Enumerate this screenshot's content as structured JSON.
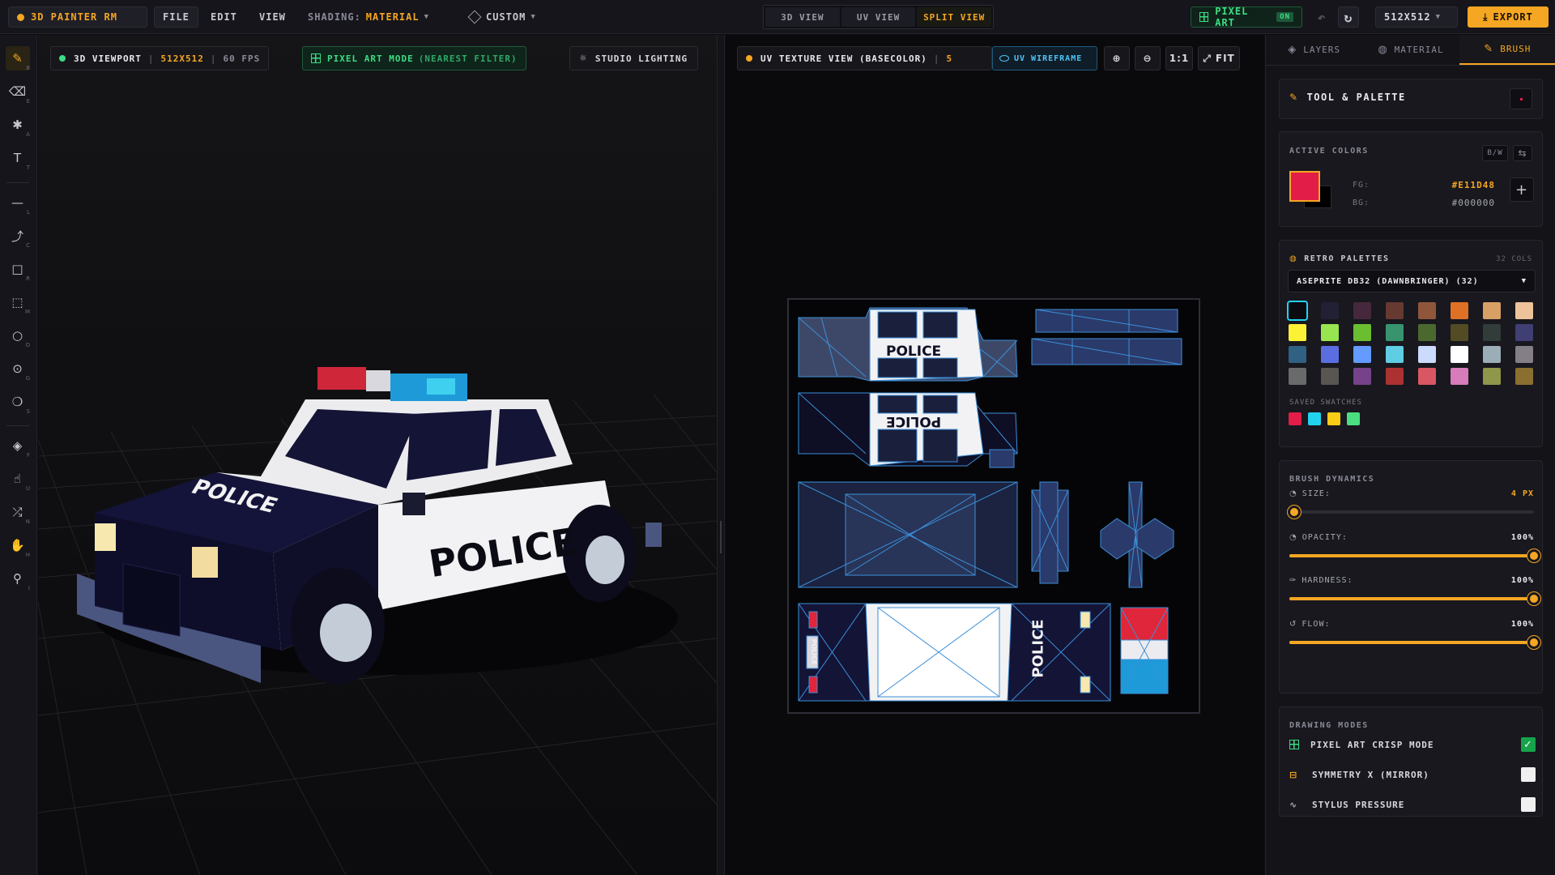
{
  "app": {
    "name": "3D Painter RM"
  },
  "menu": {
    "file": "FILE",
    "edit": "EDIT",
    "view": "VIEW",
    "shading_label": "SHADING:",
    "shading_value": "MATERIAL",
    "custom": "CUSTOM"
  },
  "view_modes": [
    "3D VIEW",
    "UV VIEW",
    "SPLIT VIEW"
  ],
  "view_mode_active": "SPLIT VIEW",
  "pixel_art_badge": {
    "label": "PIXEL ART",
    "state": "ON"
  },
  "resolution_select": "512x512",
  "export_label": "EXPORT",
  "tools": [
    {
      "name": "brush",
      "key": "B"
    },
    {
      "name": "eraser",
      "key": "E"
    },
    {
      "name": "spray",
      "key": "A"
    },
    {
      "name": "text",
      "key": "T"
    },
    {
      "name": "line",
      "key": "L"
    },
    {
      "name": "curve",
      "key": "C"
    },
    {
      "name": "rectangle",
      "key": "R"
    },
    {
      "name": "selection",
      "key": "M"
    },
    {
      "name": "ellipse",
      "key": "O"
    },
    {
      "name": "target",
      "key": "G"
    },
    {
      "name": "clone",
      "key": "S"
    },
    {
      "name": "fill",
      "key": "F"
    },
    {
      "name": "smudge",
      "key": "U"
    },
    {
      "name": "shuffle",
      "key": "N"
    },
    {
      "name": "pan",
      "key": "H"
    },
    {
      "name": "eyedropper",
      "key": "I"
    }
  ],
  "viewport3d": {
    "title": "3D VIEWPORT",
    "resolution": "512x512",
    "fps": "60 FPS",
    "pixel_mode": "PIXEL ART MODE",
    "pixel_mode_sub": "(NEAREST FILTER)",
    "lighting": "STUDIO LIGHTING",
    "car_door_text": "POLICE",
    "car_hood_text": "POLICE"
  },
  "uv": {
    "title": "UV TEXTURE VIEW (BASECOLOR)",
    "title_trail": "5",
    "wireframe": "UV WIREFRAME",
    "zoom_ratio": "1:1",
    "fit": "FIT",
    "texture_text_1": "POLICE",
    "texture_text_2": "POLICE",
    "texture_text_3": "POLICE",
    "texture_text_4": "POLICE"
  },
  "right_tabs": [
    "LAYERS",
    "MATERIAL",
    "BRUSH"
  ],
  "right_tab_active": "BRUSH",
  "tool_palette": {
    "title": "TOOL & PALETTE"
  },
  "active_colors": {
    "title": "ACTIVE COLORS",
    "bw_label": "B/W",
    "fg_label": "FG:",
    "fg_value": "#E11D48",
    "bg_label": "BG:",
    "bg_value": "#000000"
  },
  "palettes": {
    "title": "RETRO PALETTES",
    "count": "32 COLS",
    "selected": "ASEPRITE DB32 (DAWNBRINGER) (32)",
    "swatches": [
      "#0b0b12",
      "#222034",
      "#45283c",
      "#663931",
      "#8f563b",
      "#df7126",
      "#d9a066",
      "#eec39a",
      "#fbf236",
      "#99e550",
      "#6abe30",
      "#37946e",
      "#4b692f",
      "#524b24",
      "#323c39",
      "#3f3f74",
      "#306082",
      "#5b6ee1",
      "#639bff",
      "#5fcde4",
      "#cbdbfc",
      "#ffffff",
      "#9badb7",
      "#847e87",
      "#696a6a",
      "#595652",
      "#76428a",
      "#ac3232",
      "#d95763",
      "#d77bba",
      "#8f974a",
      "#8a6f30"
    ],
    "selected_index": 0,
    "saved_title": "SAVED SWATCHES",
    "saved": [
      "#e11d48",
      "#22d3ee",
      "#facc15",
      "#4ade80"
    ]
  },
  "brush_dynamics": {
    "title": "BRUSH DYNAMICS",
    "size_label": "SIZE:",
    "size_value": "4 PX",
    "size_ratio": 0.02,
    "opacity_label": "OPACITY:",
    "opacity_value": "100%",
    "opacity_ratio": 1.0,
    "hardness_label": "HARDNESS:",
    "hardness_value": "100%",
    "hardness_ratio": 1.0,
    "flow_label": "FLOW:",
    "flow_value": "100%",
    "flow_ratio": 1.0
  },
  "drawing_modes": {
    "title": "DRAWING MODES",
    "items": [
      {
        "label": "PIXEL ART CRISP MODE",
        "checked": true
      },
      {
        "label": "SYMMETRY X (MIRROR)",
        "checked": false
      },
      {
        "label": "STYLUS PRESSURE",
        "checked": false
      }
    ]
  },
  "colors": {
    "accent": "#f5a623",
    "green": "#3ddc84",
    "cyan": "#4fc3f7",
    "fg": "#e11d48"
  }
}
